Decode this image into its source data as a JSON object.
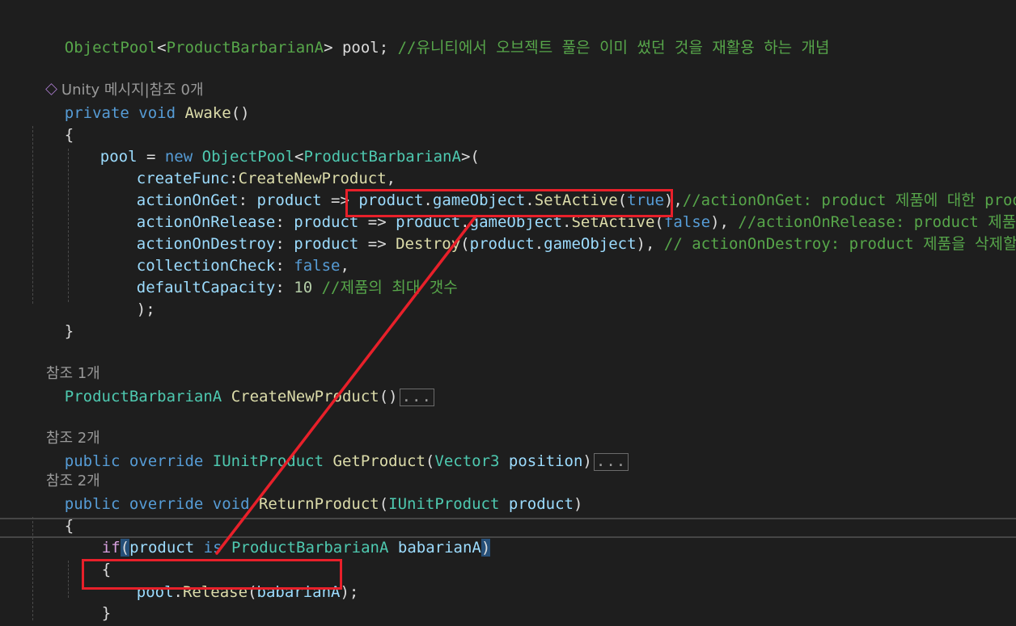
{
  "editor": {
    "lines": {
      "l1_type": "ObjectPool",
      "l1_lt": "<",
      "l1_generic": "ProductBarbarianA",
      "l1_rest": "> pool; ",
      "l1_comment": "//유니티에서 오브젝트 풀은 이미 썼던 것을 재활용 하는 개념",
      "l3_codelens": "Unity 메시지|참조 0개",
      "l4_kw": "private void ",
      "l4_method": "Awake",
      "l4_rest": "()",
      "l5": "{",
      "l6_pool": "pool",
      "l6_eq": " = ",
      "l6_new": "new ",
      "l6_type": "ObjectPool",
      "l6_lt": "<",
      "l6_generic": "ProductBarbarianA",
      "l6_rest": ">(",
      "l7_param": "createFunc",
      "l7_colon": ":",
      "l7_method": "CreateNewProduct",
      "l7_rest": ",",
      "l8_param": "actionOnGet",
      "l8_a": ": ",
      "l8_p": "product",
      "l8_arrow": " => ",
      "l8_p2": "product",
      "l8_dot": ".",
      "l8_go": "gameObject",
      "l8_dot2": ".",
      "l8_method": "SetActive",
      "l8_open": "(",
      "l8_bool": "true",
      "l8_close": "),",
      "l8_comment": "//actionOnGet: product 제품에 대한 product(행",
      "l9_param": "actionOnRelease",
      "l9_a": ": ",
      "l9_p": "product",
      "l9_arrow": " => ",
      "l9_p2": "product",
      "l9_dot": ".",
      "l9_go": "gameObject",
      "l9_dot2": ".",
      "l9_method": "SetActive",
      "l9_open": "(",
      "l9_bool": "false",
      "l9_close": "), ",
      "l9_comment": "//actionOnRelease: product 제품을 돌려",
      "l10_param": "actionOnDestroy",
      "l10_a": ": ",
      "l10_p": "product",
      "l10_arrow": " => ",
      "l10_method": "Destroy",
      "l10_open": "(",
      "l10_p2": "product",
      "l10_dot": ".",
      "l10_go": "gameObject",
      "l10_close": "), ",
      "l10_comment": "// actionOnDestroy: product 제품을 삭제할 때 C",
      "l11_param": "collectionCheck",
      "l11_a": ": ",
      "l11_bool": "false",
      "l11_rest": ",",
      "l12_param": "defaultCapacity",
      "l12_a": ": ",
      "l12_num": "10",
      "l12_sp": " ",
      "l12_comment": "//제품의 최대 갯수",
      "l13": ");",
      "l14": "}",
      "l16_codelens": "참조 1개",
      "l17_type": "ProductBarbarianA",
      "l17_sp": " ",
      "l17_method": "CreateNewProduct",
      "l17_rest": "()",
      "l17_fold": "...",
      "l19_codelens": "참조 2개",
      "l20_kw": "public override ",
      "l20_type": "IUnitProduct",
      "l20_sp": " ",
      "l20_method": "GetProduct",
      "l20_open": "(",
      "l20_type2": "Vector3",
      "l20_sp2": " ",
      "l20_param": "position",
      "l20_close": ")",
      "l20_fold": "...",
      "l21_codelens": "참조 2개",
      "l22_kw": "public override void ",
      "l22_method": "ReturnProduct",
      "l22_open": "(",
      "l22_type": "IUnitProduct",
      "l22_sp": " ",
      "l22_param": "product",
      "l22_close": ")",
      "l23": "{",
      "l24_if": "if",
      "l24_open": "(",
      "l24_p": "product",
      "l24_is": " is ",
      "l24_type": "ProductBarbarianA",
      "l24_sp": " ",
      "l24_var": "babarianA",
      "l24_close": ")",
      "l25": "{",
      "l26_pool": "pool",
      "l26_dot": ".",
      "l26_method": "Release",
      "l26_open": "(",
      "l26_var": "babarianA",
      "l26_close": ");",
      "l27": "}",
      "l28": "}"
    },
    "codelens_icon": "unity-cube-icon",
    "colors": {
      "background": "#1e1e1e",
      "comment": "#57a64a",
      "keyword": "#569cd6",
      "control": "#d8a0df",
      "type": "#4ec9b0",
      "method": "#dcdcaa",
      "parameter": "#9cdcfe",
      "number": "#b5cea8",
      "annotation_red": "#e8202a"
    }
  },
  "annotations": {
    "highlight_boxes": [
      "setactive-false-box",
      "pool-release-box"
    ],
    "arrow": "release-to-setactive-arrow"
  }
}
